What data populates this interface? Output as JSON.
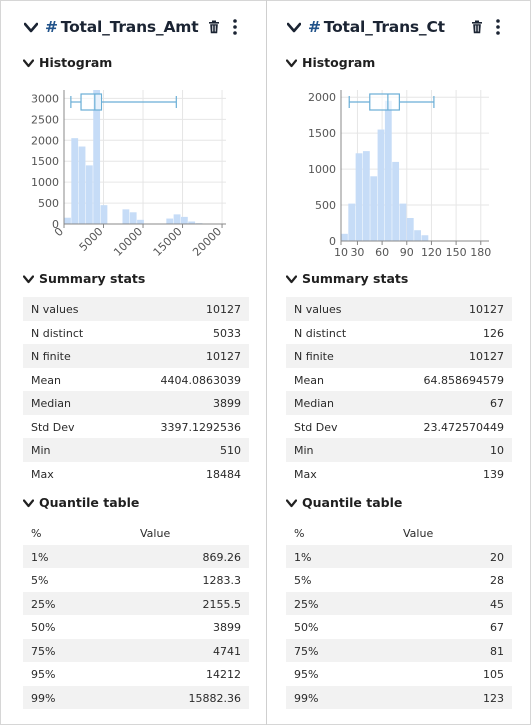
{
  "panels": [
    {
      "hash": "#",
      "title": "Total_Trans_Amt",
      "histogram_label": "Histogram",
      "summary_label": "Summary stats",
      "quantile_label": "Quantile table",
      "summary": [
        {
          "k": "N values",
          "v": "10127"
        },
        {
          "k": "N distinct",
          "v": "5033"
        },
        {
          "k": "N finite",
          "v": "10127"
        },
        {
          "k": "Mean",
          "v": "4404.0863039"
        },
        {
          "k": "Median",
          "v": "3899"
        },
        {
          "k": "Std Dev",
          "v": "3397.1292536"
        },
        {
          "k": "Min",
          "v": "510"
        },
        {
          "k": "Max",
          "v": "18484"
        }
      ],
      "quantile_header": {
        "k": "%",
        "v": "Value"
      },
      "quantiles": [
        {
          "k": "1%",
          "v": "869.26"
        },
        {
          "k": "5%",
          "v": "1283.3"
        },
        {
          "k": "25%",
          "v": "2155.5"
        },
        {
          "k": "50%",
          "v": "3899"
        },
        {
          "k": "75%",
          "v": "4741"
        },
        {
          "k": "95%",
          "v": "14212"
        },
        {
          "k": "99%",
          "v": "15882.36"
        }
      ]
    },
    {
      "hash": "#",
      "title": "Total_Trans_Ct",
      "histogram_label": "Histogram",
      "summary_label": "Summary stats",
      "quantile_label": "Quantile table",
      "summary": [
        {
          "k": "N values",
          "v": "10127"
        },
        {
          "k": "N distinct",
          "v": "126"
        },
        {
          "k": "N finite",
          "v": "10127"
        },
        {
          "k": "Mean",
          "v": "64.858694579"
        },
        {
          "k": "Median",
          "v": "67"
        },
        {
          "k": "Std Dev",
          "v": "23.472570449"
        },
        {
          "k": "Min",
          "v": "10"
        },
        {
          "k": "Max",
          "v": "139"
        }
      ],
      "quantile_header": {
        "k": "%",
        "v": "Value"
      },
      "quantiles": [
        {
          "k": "1%",
          "v": "20"
        },
        {
          "k": "5%",
          "v": "28"
        },
        {
          "k": "25%",
          "v": "45"
        },
        {
          "k": "50%",
          "v": "67"
        },
        {
          "k": "75%",
          "v": "81"
        },
        {
          "k": "95%",
          "v": "105"
        },
        {
          "k": "99%",
          "v": "123"
        }
      ]
    }
  ],
  "colors": {
    "bar": "#c6dcf7",
    "box": "#6aaed6",
    "grid": "#e6e6e6",
    "axis": "#888888",
    "tick_text": "#555555",
    "header_icon": "#1b2433"
  },
  "icons": {
    "collapse": "chevron-down-icon",
    "delete": "trash-icon",
    "menu": "kebab-menu-icon"
  },
  "chart_data": [
    {
      "type": "bar",
      "title": "",
      "xlabel": "",
      "ylabel": "",
      "x_ticks": [
        0,
        5000,
        10000,
        15000,
        20000
      ],
      "x_tick_labels": [
        "0",
        "5000",
        "10000",
        "15000",
        "20000"
      ],
      "x_tick_rotation": -45,
      "y_ticks": [
        0,
        500,
        1000,
        1500,
        2000,
        2500,
        3000
      ],
      "y_tick_labels": [
        "0",
        "500",
        "1000",
        "1500",
        "2000",
        "2500",
        "3000"
      ],
      "xlim": [
        0,
        20500
      ],
      "ylim": [
        0,
        3200
      ],
      "grid": true,
      "bin_width": 925,
      "bins_start": 0,
      "values": [
        150,
        2050,
        1850,
        1400,
        3200,
        450,
        0,
        0,
        350,
        280,
        100,
        0,
        0,
        0,
        130,
        230,
        170,
        60,
        20,
        0
      ],
      "box": {
        "whisker_low": 869.26,
        "q1": 2155.5,
        "median": 3899,
        "q3": 4741,
        "whisker_high": 14212
      }
    },
    {
      "type": "bar",
      "title": "",
      "xlabel": "",
      "ylabel": "",
      "x_ticks": [
        10,
        30,
        60,
        90,
        120,
        150,
        180
      ],
      "x_tick_labels": [
        "10",
        "30",
        "60",
        "90",
        "120",
        "150",
        "180"
      ],
      "x_tick_rotation": 0,
      "y_ticks": [
        0,
        500,
        1000,
        1500,
        2000
      ],
      "y_tick_labels": [
        "0",
        "500",
        "1000",
        "1500",
        "2000"
      ],
      "xlim": [
        10,
        190
      ],
      "ylim": [
        0,
        2100
      ],
      "grid": true,
      "bin_width": 8.9,
      "bins_start": 10,
      "values": [
        100,
        520,
        1220,
        1250,
        900,
        1550,
        1950,
        1100,
        520,
        320,
        150,
        80,
        0,
        0,
        0,
        0,
        0,
        0,
        0,
        0
      ],
      "box": {
        "whisker_low": 20,
        "q1": 45,
        "median": 67,
        "q3": 81,
        "whisker_high": 123
      }
    }
  ]
}
